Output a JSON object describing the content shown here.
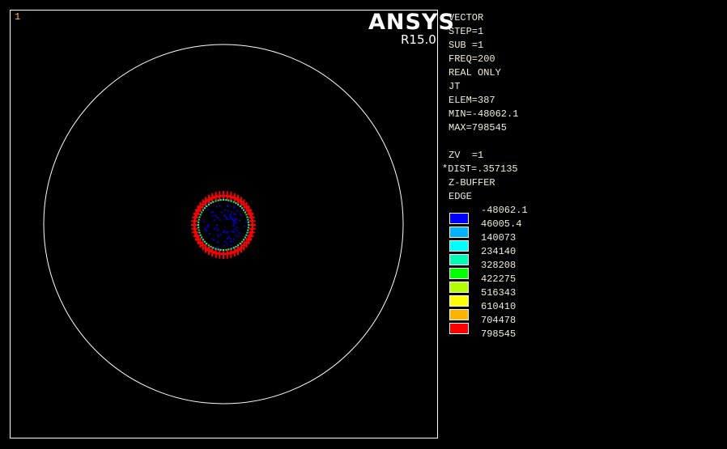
{
  "window_number": "1",
  "logo": "ANSYS",
  "version": "R15.0",
  "info": [
    "VECTOR",
    "STEP=1",
    "SUB =1",
    "FREQ=200",
    "REAL ONLY",
    "JT",
    "ELEM=387",
    "MIN=-48062.1",
    "MAX=798545"
  ],
  "view": [
    "ZV  =1",
    "*DIST=.357135",
    "Z-BUFFER",
    "EDGE"
  ],
  "legend": {
    "values": [
      "-48062.1",
      "46005.4",
      "140073",
      "234140",
      "328208",
      "422275",
      "516343",
      "610410",
      "704478",
      "798545"
    ],
    "colors": [
      "#0000ff",
      "#00b2ff",
      "#00ffff",
      "#00ffb2",
      "#00ff00",
      "#b2ff00",
      "#ffff00",
      "#ffb200",
      "#ff0000"
    ]
  }
}
